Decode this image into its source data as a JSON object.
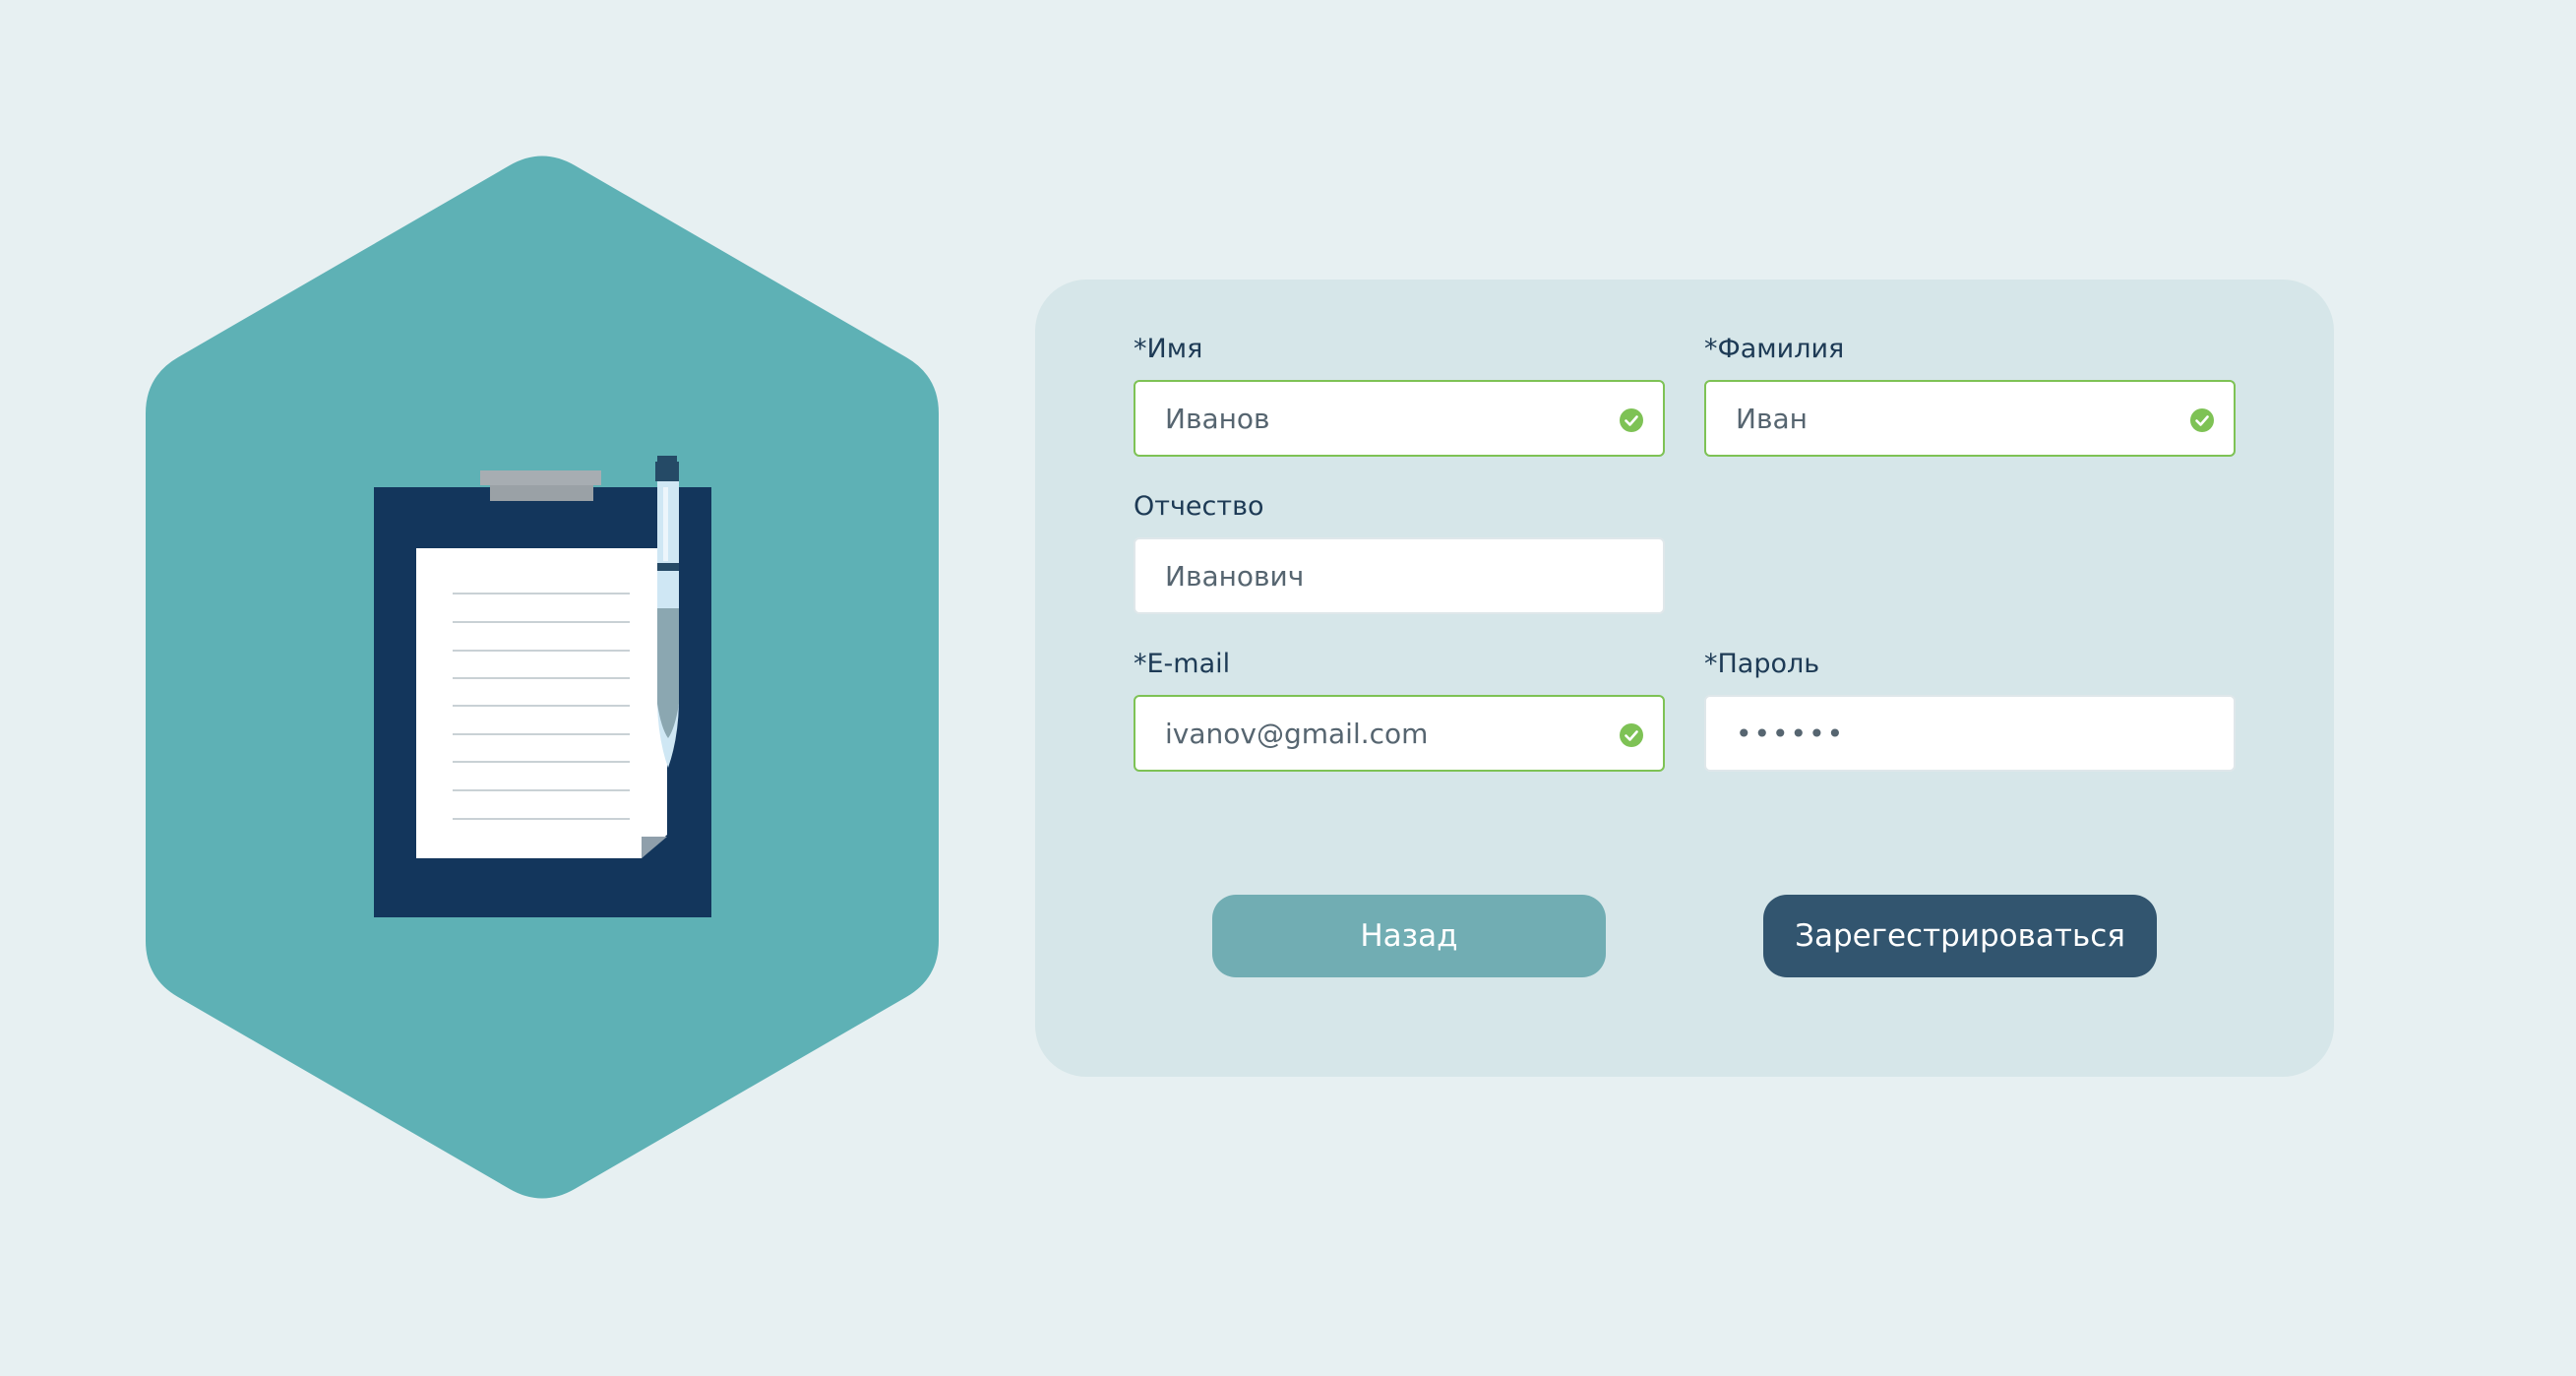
{
  "theme": {
    "page_background": "#e7f0f2",
    "hexagon_color": "#5eb1b5",
    "card_background": "#d6e6e9",
    "valid_border": "#7ec255",
    "back_button": "#71adb3",
    "register_button": "#32556f"
  },
  "illustration": {
    "icon": "clipboard-with-pen-icon"
  },
  "form": {
    "first_name": {
      "label": "*Имя",
      "value": "Иванов",
      "valid": true
    },
    "last_name": {
      "label": "*Фамилия",
      "value": "Иван",
      "valid": true
    },
    "patronymic": {
      "label": "Отчество",
      "value": "Иванович",
      "valid": false
    },
    "email": {
      "label": "*E-mail",
      "value": "ivanov@gmail.com",
      "valid": true
    },
    "password": {
      "label": "*Пароль",
      "value": "••••••",
      "valid": false
    }
  },
  "buttons": {
    "back_label": "Назад",
    "register_label": "Зарегестрироваться"
  },
  "icons": {
    "valid_check": "check-circle-icon"
  }
}
